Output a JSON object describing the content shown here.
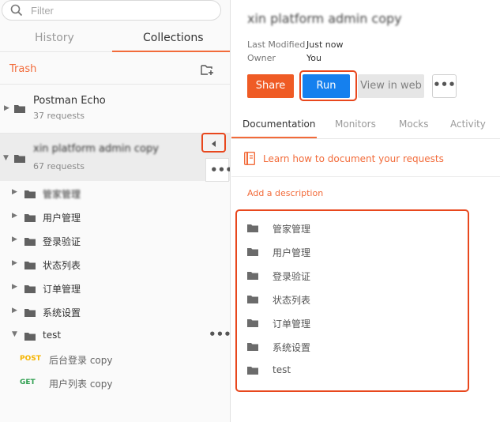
{
  "search": {
    "placeholder": "Filter"
  },
  "sidebar_tabs": {
    "history": "History",
    "collections": "Collections"
  },
  "trash_label": "Trash",
  "collections": [
    {
      "name": "Postman Echo",
      "count": "37 requests"
    },
    {
      "name": "xin platform admin copy",
      "count": "67 requests"
    }
  ],
  "folders": [
    "管家管理",
    "用户管理",
    "登录验证",
    "状态列表",
    "订单管理",
    "系统设置",
    "test"
  ],
  "requests": [
    {
      "method": "POST",
      "name": "后台登录 copy"
    },
    {
      "method": "GET",
      "name": "用户列表 copy"
    }
  ],
  "detail": {
    "title": "xin platform admin copy",
    "last_modified_label": "Last Modified",
    "last_modified_value": "Just now",
    "owner_label": "Owner",
    "owner_value": "You",
    "share": "Share",
    "run": "Run",
    "view_web": "View in web",
    "tabs": [
      "Documentation",
      "Monitors",
      "Mocks",
      "Activity"
    ],
    "learn_link": "Learn how to document your requests",
    "add_description": "Add a description",
    "folders": [
      "管家管理",
      "用户管理",
      "登录验证",
      "状态列表",
      "订单管理",
      "系统设置",
      "test"
    ]
  },
  "colors": {
    "accent": "#f26b3a",
    "run": "#1580ee",
    "highlight": "#e8471d"
  }
}
